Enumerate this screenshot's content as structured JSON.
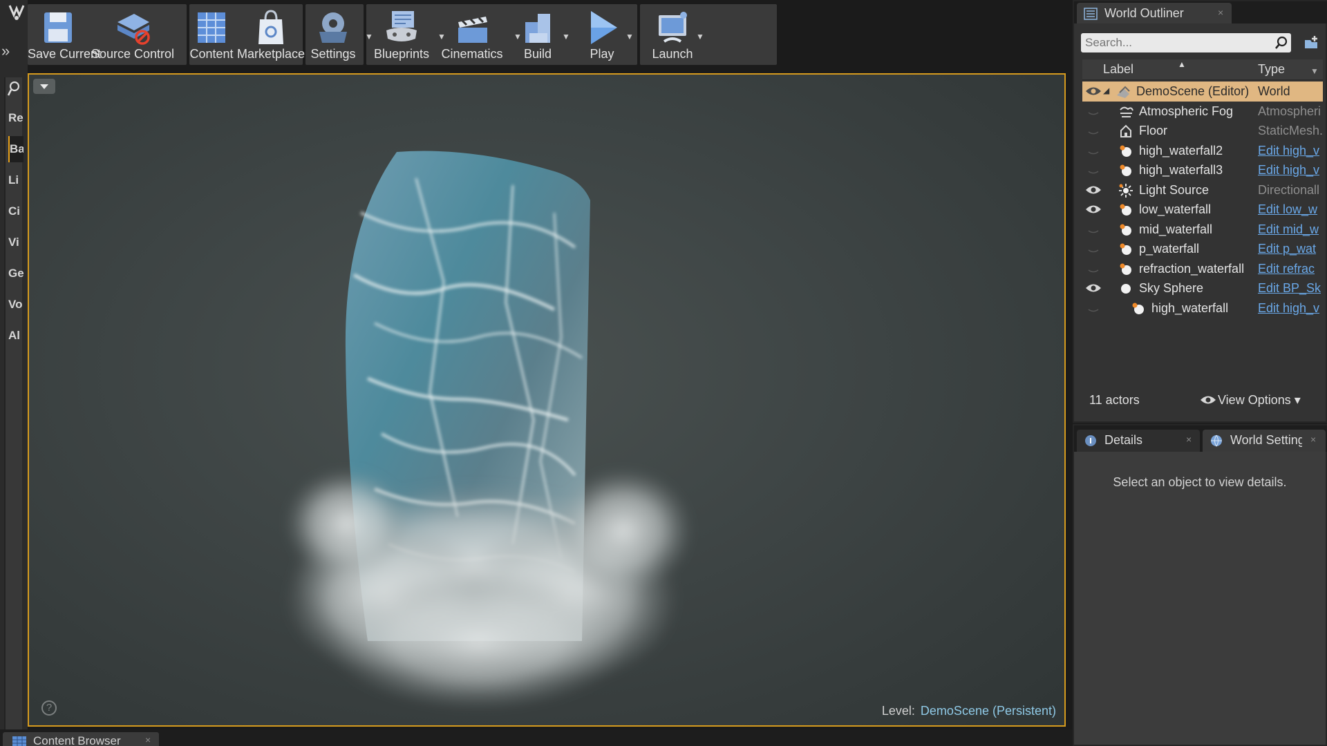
{
  "toolbar": {
    "buttons": [
      {
        "label": "Save Current",
        "icon": "save-icon",
        "has_menu": false
      },
      {
        "label": "Source Control",
        "icon": "source-control-icon",
        "has_menu": true
      },
      {
        "label": "Content",
        "icon": "content-grid-icon",
        "has_menu": false
      },
      {
        "label": "Marketplace",
        "icon": "marketplace-bag-icon",
        "has_menu": false
      },
      {
        "label": "Settings",
        "icon": "settings-gear-icon",
        "has_menu": true
      },
      {
        "label": "Blueprints",
        "icon": "blueprints-icon",
        "has_menu": true
      },
      {
        "label": "Cinematics",
        "icon": "cinematics-clapper-icon",
        "has_menu": true
      },
      {
        "label": "Build",
        "icon": "build-icon",
        "has_menu": true
      },
      {
        "label": "Play",
        "icon": "play-icon",
        "has_menu": true
      },
      {
        "label": "Launch",
        "icon": "launch-icon",
        "has_menu": true
      }
    ]
  },
  "modes": {
    "tabs": [
      {
        "label": "Re",
        "active": false
      },
      {
        "label": "Ba",
        "active": true
      },
      {
        "label": "Li",
        "active": false
      },
      {
        "label": "Ci",
        "active": false
      },
      {
        "label": "Vi",
        "active": false
      },
      {
        "label": "Ge",
        "active": false
      },
      {
        "label": "Vo",
        "active": false
      },
      {
        "label": "Al",
        "active": false
      }
    ]
  },
  "viewport": {
    "level_label": "Level:",
    "level_name": "DemoScene (Persistent)",
    "help_glyph": "?"
  },
  "bottom": {
    "content_browser_tab": "Content Browser",
    "close_glyph": "×"
  },
  "outliner": {
    "tab_label": "World Outliner",
    "close_glyph": "×",
    "search_placeholder": "Search...",
    "col_label": "Label",
    "col_type": "Type",
    "rows": [
      {
        "label": "DemoScene (Editor)",
        "type": "World",
        "visible": true,
        "depth": 0,
        "expander": "◢",
        "icon": "world-icon",
        "link": false,
        "selected": true
      },
      {
        "label": "Atmospheric Fog",
        "type": "Atmospheri",
        "visible": false,
        "depth": 1,
        "expander": "",
        "icon": "fog-icon",
        "link": false,
        "selected": false
      },
      {
        "label": "Floor",
        "type": "StaticMesh.",
        "visible": false,
        "depth": 1,
        "expander": "",
        "icon": "static-mesh-icon",
        "link": false,
        "selected": false
      },
      {
        "label": "high_waterfall2",
        "type": "Edit high_v",
        "visible": false,
        "depth": 1,
        "expander": "",
        "icon": "blueprint-actor-icon",
        "link": true,
        "selected": false
      },
      {
        "label": "high_waterfall3",
        "type": "Edit high_v",
        "visible": false,
        "depth": 1,
        "expander": "",
        "icon": "blueprint-actor-icon",
        "link": true,
        "selected": false
      },
      {
        "label": "Light Source",
        "type": "Directionall",
        "visible": true,
        "depth": 1,
        "expander": "",
        "icon": "directional-light-icon",
        "link": false,
        "selected": false
      },
      {
        "label": "low_waterfall",
        "type": "Edit low_w",
        "visible": true,
        "depth": 1,
        "expander": "",
        "icon": "blueprint-actor-icon",
        "link": true,
        "selected": false
      },
      {
        "label": "mid_waterfall",
        "type": "Edit mid_w",
        "visible": false,
        "depth": 1,
        "expander": "",
        "icon": "blueprint-actor-icon",
        "link": true,
        "selected": false
      },
      {
        "label": "p_waterfall",
        "type": "Edit p_wat",
        "visible": false,
        "depth": 1,
        "expander": "",
        "icon": "blueprint-actor-icon",
        "link": true,
        "selected": false
      },
      {
        "label": "refraction_waterfall",
        "type": "Edit refrac",
        "visible": false,
        "depth": 1,
        "expander": "",
        "icon": "blueprint-actor-icon",
        "link": true,
        "selected": false
      },
      {
        "label": "Sky Sphere",
        "type": "Edit BP_Sk",
        "visible": true,
        "depth": 1,
        "expander": "◢",
        "icon": "sky-sphere-icon",
        "link": true,
        "selected": false
      },
      {
        "label": "high_waterfall",
        "type": "Edit high_v",
        "visible": false,
        "depth": 2,
        "expander": "",
        "icon": "blueprint-actor-icon",
        "link": true,
        "selected": false
      }
    ],
    "actor_count": "11 actors",
    "view_options": "View Options",
    "view_options_caret": "▾"
  },
  "details": {
    "tab_label": "Details",
    "world_settings_tab": "World Settings",
    "close_glyph": "×",
    "empty_message": "Select an object to view details."
  },
  "colors": {
    "accent": "#d69b1e",
    "selected_row": "#e0b782",
    "link": "#6aa8e8",
    "level_name": "#8fc9e6"
  }
}
